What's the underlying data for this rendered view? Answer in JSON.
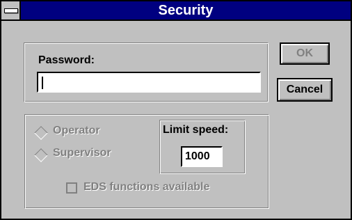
{
  "window": {
    "title": "Security"
  },
  "password": {
    "label": "Password:",
    "value": ""
  },
  "buttons": {
    "ok": "OK",
    "cancel": "Cancel"
  },
  "access": {
    "operator_label": "Operator",
    "supervisor_label": "Supervisor",
    "limit_speed_label": "Limit speed:",
    "limit_speed_value": "1000",
    "eds_label": "EDS functions available"
  },
  "colors": {
    "title_bar": "#000080",
    "dialog_face": "#c0c0c0",
    "disabled_text": "#808080"
  },
  "icons": {
    "system_menu": "system-menu-icon"
  }
}
